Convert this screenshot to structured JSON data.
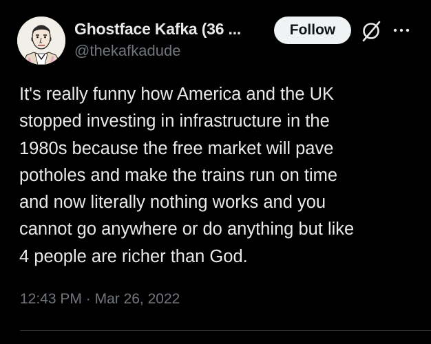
{
  "author": {
    "display_name": "Ghostface Kafka (36 ...",
    "handle": "@thekafkadude"
  },
  "actions": {
    "follow_label": "Follow",
    "grok_icon": "grok-slash-icon",
    "more_icon": "more-dots-icon"
  },
  "tweet": {
    "lines": [
      "It's really funny how America and the UK",
      "stopped investing in infrastructure in the",
      "1980s because the free market will pave",
      "potholes and make the trains run on time",
      "and now literally nothing works and you",
      "cannot go anywhere or do anything but like",
      "4 people are richer than God."
    ],
    "time": "12:43 PM",
    "separator": "·",
    "date": "Mar 26, 2022"
  },
  "colors": {
    "background": "#000000",
    "primary_text": "#e7e9ea",
    "secondary_text": "#71767b",
    "follow_bg": "#eff3f4",
    "follow_text": "#0f1419",
    "divider": "#2f3336"
  }
}
